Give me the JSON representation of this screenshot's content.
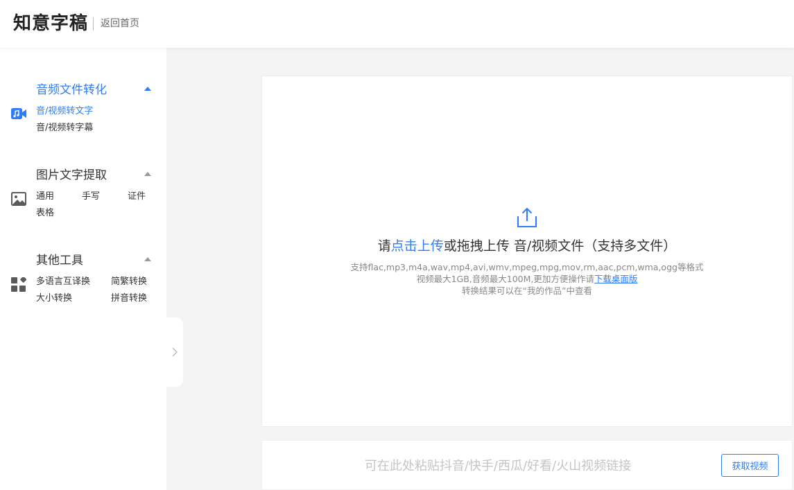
{
  "header": {
    "logo": "知意字稿",
    "back_link": "返回首页"
  },
  "sidebar": {
    "sections": [
      {
        "title": "音频文件转化",
        "icon": "music-video-icon",
        "active": true,
        "items": [
          "音/视频转文字",
          "音/视频转字幕"
        ]
      },
      {
        "title": "图片文字提取",
        "icon": "image-icon",
        "active": false,
        "items": [
          "通用",
          "手写",
          "证件",
          "表格"
        ]
      },
      {
        "title": "其他工具",
        "icon": "apps-grid-icon",
        "active": false,
        "items": [
          "多语言互译换",
          "简繁转换",
          "大小转换",
          "拼音转换"
        ]
      }
    ]
  },
  "upload": {
    "title_prefix": "请",
    "title_link": "点击上传",
    "title_suffix": "或拖拽上传 音/视频文件（支持多文件）",
    "formats": "支持flac,mp3,m4a,wav,mp4,avi,wmv,mpeg,mpg,mov,rm,aac,pcm,wma,ogg等格式",
    "limits": "视频最大1GB,音频最大100M,更加方便操作请",
    "download_link": "下载桌面版",
    "result_note": "转换结果可以在“我的作品”中查看"
  },
  "link_bar": {
    "placeholder": "可在此处粘贴抖音/快手/西瓜/好看/火山视频链接",
    "value": "",
    "button": "获取视频"
  },
  "colors": {
    "accent": "#2f7df6",
    "background": "#f4f4f4"
  }
}
